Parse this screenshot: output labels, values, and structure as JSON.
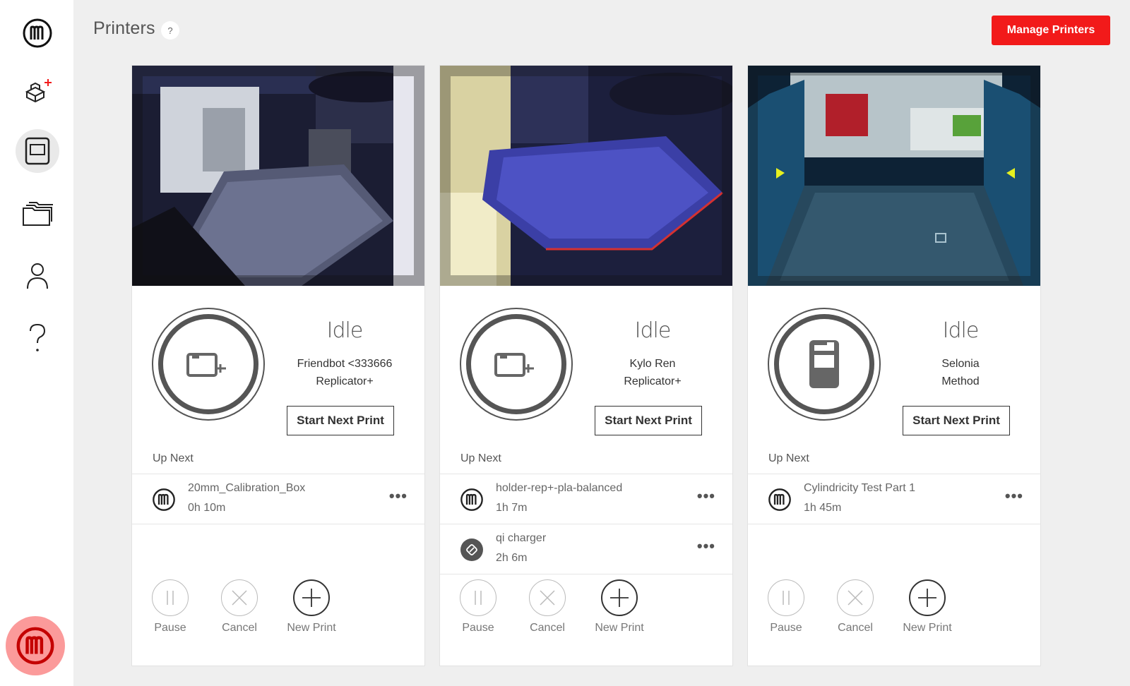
{
  "header": {
    "title": "Printers",
    "help": "?",
    "manage_button": "Manage Printers"
  },
  "sidebar": {
    "items": [
      {
        "icon": "makerbot-logo-icon"
      },
      {
        "icon": "add-model-icon"
      },
      {
        "icon": "printer-icon",
        "active": true
      },
      {
        "icon": "folders-icon"
      },
      {
        "icon": "user-icon"
      },
      {
        "icon": "help-icon"
      }
    ],
    "footer_icon": "makerbot-logo-icon"
  },
  "printers": [
    {
      "status": "Idle",
      "name": "Friendbot <333666",
      "model": "Replicator+",
      "start_button": "Start Next Print",
      "up_next_label": "Up Next",
      "queue": [
        {
          "name": "20mm_Calibration_Box",
          "time": "0h 10m",
          "icon": "makerbot-logo-icon"
        }
      ],
      "actions": {
        "pause": "Pause",
        "cancel": "Cancel",
        "new_print": "New Print"
      }
    },
    {
      "status": "Idle",
      "name": "Kylo Ren",
      "model": "Replicator+",
      "start_button": "Start Next Print",
      "up_next_label": "Up Next",
      "queue": [
        {
          "name": "holder-rep+-pla-balanced",
          "time": "1h 7m",
          "icon": "makerbot-logo-icon"
        },
        {
          "name": "qi charger",
          "time": "2h 6m",
          "icon": "link-icon"
        }
      ],
      "actions": {
        "pause": "Pause",
        "cancel": "Cancel",
        "new_print": "New Print"
      }
    },
    {
      "status": "Idle",
      "name": "Selonia",
      "model": "Method",
      "start_button": "Start Next Print",
      "up_next_label": "Up Next",
      "queue": [
        {
          "name": "Cylindricity Test Part 1",
          "time": "1h 45m",
          "icon": "makerbot-logo-icon"
        }
      ],
      "actions": {
        "pause": "Pause",
        "cancel": "Cancel",
        "new_print": "New Print"
      }
    }
  ],
  "colors": {
    "accent": "#f21a1a",
    "brand_bubble": "#fb9a9a",
    "background": "#efefef"
  }
}
